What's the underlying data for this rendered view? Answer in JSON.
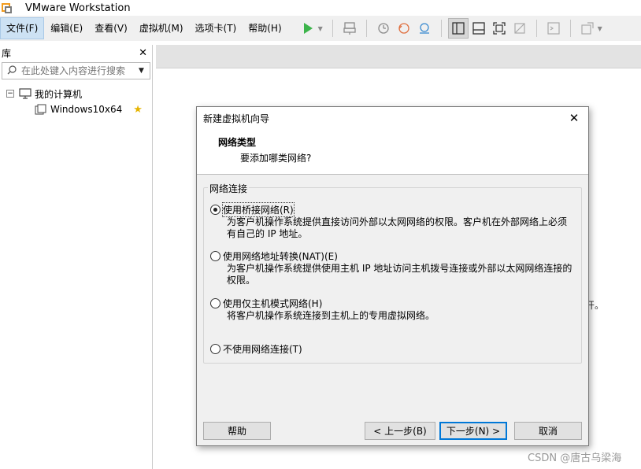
{
  "app": {
    "title": "VMware Workstation"
  },
  "menubar": {
    "items": [
      {
        "label": "文件(F)",
        "active": true
      },
      {
        "label": "编辑(E)"
      },
      {
        "label": "查看(V)"
      },
      {
        "label": "虚拟机(M)"
      },
      {
        "label": "选项卡(T)"
      },
      {
        "label": "帮助(H)"
      }
    ]
  },
  "toolbar": {
    "icons": [
      "play-icon",
      "send-keys-icon",
      "snapshot-icon",
      "revert-snapshot-icon",
      "manage-snapshots-icon",
      "show-library-icon",
      "thumbnail-bar-icon",
      "full-screen-icon",
      "unity-icon",
      "console-icon",
      "stretch-icon"
    ]
  },
  "library": {
    "title": "库",
    "search_placeholder": "在此处键入内容进行搜索",
    "tree": {
      "root": "我的计算机",
      "children": [
        {
          "label": "Windows10x64",
          "favorite": true
        }
      ]
    }
  },
  "main": {
    "bg_fragment": "开。",
    "watermark": "CSDN @唐古乌梁海"
  },
  "dialog": {
    "title": "新建虚拟机向导",
    "heading": "网络类型",
    "subheading": "要添加哪类网络?",
    "group_label": "网络连接",
    "options": [
      {
        "label": "使用桥接网络(R)",
        "selected": true,
        "description_lines": [
          "为客户机操作系统提供直接访问外部以太网网络的权限。客户机在外部网络上必须",
          "有自己的 IP 地址。"
        ]
      },
      {
        "label": "使用网络地址转换(NAT)(E)",
        "selected": false,
        "description_lines": [
          "为客户机操作系统提供使用主机 IP 地址访问主机拨号连接或外部以太网网络连接的",
          "权限。"
        ]
      },
      {
        "label": "使用仅主机模式网络(H)",
        "selected": false,
        "description_lines": [
          "将客户机操作系统连接到主机上的专用虚拟网络。"
        ]
      },
      {
        "label": "不使用网络连接(T)",
        "selected": false,
        "description_lines": []
      }
    ],
    "buttons": {
      "help": "帮助",
      "back": "< 上一步(B)",
      "next": "下一步(N) >",
      "cancel": "取消"
    }
  }
}
